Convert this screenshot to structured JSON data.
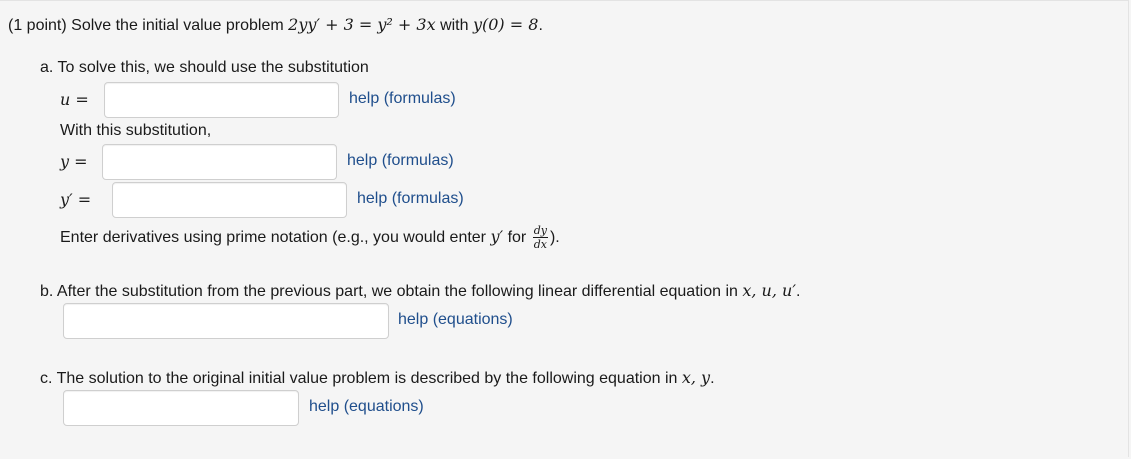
{
  "problem": {
    "prefix": "(1 point) Solve the initial value problem ",
    "equation": "2yy′ + 3 = y² + 3x",
    "with": " with ",
    "initial": "y(0) = 8",
    "suffix": "."
  },
  "part_a": {
    "intro": "a. To solve this, we should use the substitution",
    "u_label": "u =",
    "with_sub": "With this substitution,",
    "y_label": "y =",
    "yprime_label": "y′ =",
    "note_prefix": "Enter derivatives using prime notation (e.g., you would enter ",
    "note_var": "y′",
    "note_for": " for ",
    "note_num": "dy",
    "note_den": "dx",
    "note_suffix": ")."
  },
  "part_b": {
    "text_prefix": "b. After the substitution from the previous part, we obtain the following linear differential equation in ",
    "vars": "x, u, u′",
    "text_suffix": "."
  },
  "part_c": {
    "text_prefix": "c. The solution to the original initial value problem is described by the following equation in ",
    "vars": "x, y",
    "text_suffix": "."
  },
  "help": {
    "formulas": "help (formulas)",
    "equations": "help (equations)"
  },
  "inputs": {
    "u_value": "",
    "y_value": "",
    "yprime_value": "",
    "b_value": "",
    "c_value": ""
  }
}
